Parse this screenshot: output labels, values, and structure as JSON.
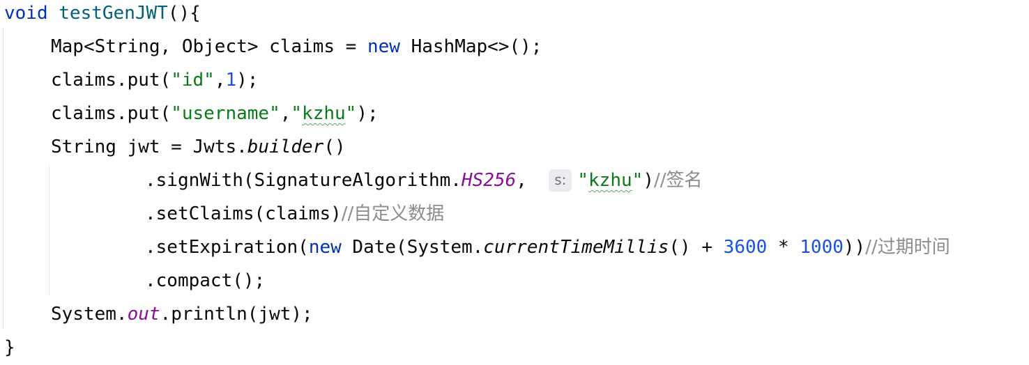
{
  "code": {
    "method_decl": {
      "kw": "void",
      "name": "testGenJWT",
      "open": "(){"
    },
    "map_line": {
      "text1": "Map<String, Object> claims = ",
      "kw_new": "new",
      "text2": " HashMap<>();"
    },
    "put_id": {
      "text1": "claims.put(",
      "key": "\"id\"",
      "comma": ",",
      "value": "1",
      "close": ");"
    },
    "put_username": {
      "text1": "claims.put(",
      "key": "\"username\"",
      "comma": ",",
      "q_open": "\"",
      "value_word": "kzhu",
      "q_close": "\"",
      "close": ");"
    },
    "jwt_decl": {
      "text1": "String jwt = Jwts.",
      "call": "builder",
      "close": "()"
    },
    "sign_with": {
      "text1": ".signWith(SignatureAlgorithm.",
      "field": "HS256",
      "comma": ",",
      "hint": "s:",
      "q_open": "\"",
      "value_word": "kzhu",
      "q_close": "\"",
      "close": ")",
      "comment": "//签名"
    },
    "set_claims": {
      "text1": ".setClaims(claims)",
      "comment": "//自定义数据"
    },
    "set_expiration": {
      "text1": ".setExpiration(",
      "kw_new": "new",
      "text2": " Date(System.",
      "call": "currentTimeMillis",
      "text3": "() + ",
      "num1": "3600",
      "op": " * ",
      "num2": "1000",
      "close": "))",
      "comment": "//过期时间"
    },
    "compact": {
      "text": ".compact();"
    },
    "println": {
      "text1": "System.",
      "field": "out",
      "text2": ".println(jwt);"
    },
    "closing_brace": {
      "text": "}"
    }
  },
  "colors": {
    "keyword": "#0033b3",
    "method_name": "#00627a",
    "string": "#067d17",
    "number": "#1750eb",
    "comment": "#8c8c8c",
    "static_field": "#871094"
  }
}
